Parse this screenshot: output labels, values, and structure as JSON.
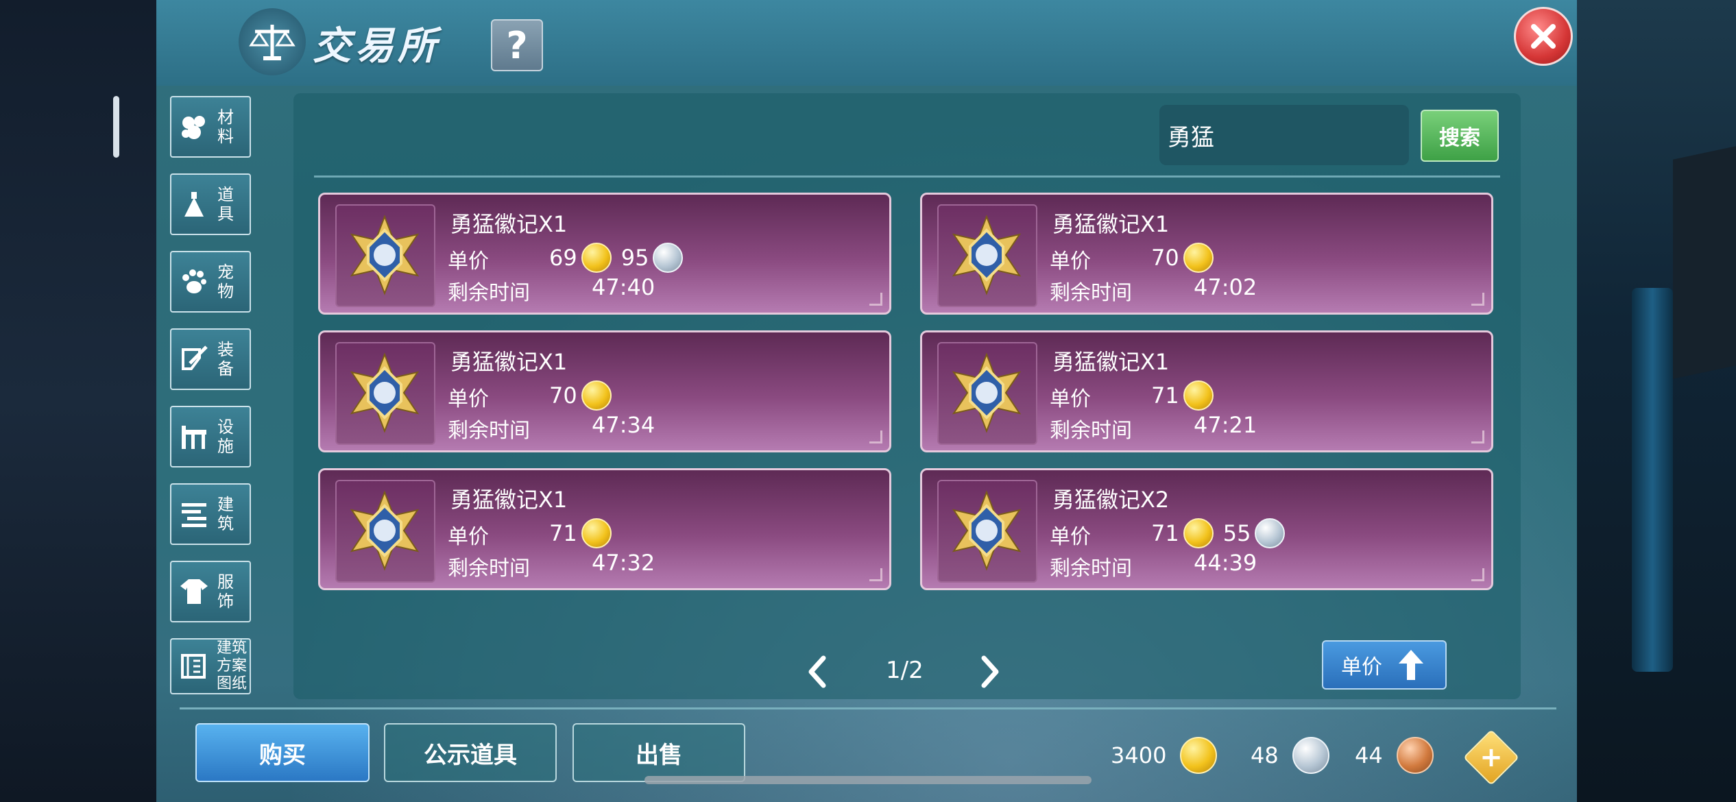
{
  "title": "交易所",
  "help_label": "?",
  "categories": [
    {
      "label": "材料",
      "icon": "materials-icon"
    },
    {
      "label": "道具",
      "icon": "item-icon"
    },
    {
      "label": "宠物",
      "icon": "paw-icon"
    },
    {
      "label": "装备",
      "icon": "equipment-icon"
    },
    {
      "label": "设施",
      "icon": "facility-icon"
    },
    {
      "label": "建筑",
      "icon": "building-icon"
    },
    {
      "label": "服饰",
      "icon": "clothing-icon"
    },
    {
      "label": "建筑方案图纸",
      "icon": "blueprint-icon"
    }
  ],
  "search": {
    "value": "勇猛",
    "button": "搜索"
  },
  "price_label": "单价",
  "time_label": "剩余时间",
  "listings": [
    {
      "name": "勇猛徽记X1",
      "gold": "69",
      "silver": "95",
      "time": "47:40"
    },
    {
      "name": "勇猛徽记X1",
      "gold": "70",
      "silver": "",
      "time": "47:02"
    },
    {
      "name": "勇猛徽记X1",
      "gold": "70",
      "silver": "",
      "time": "47:34"
    },
    {
      "name": "勇猛徽记X1",
      "gold": "71",
      "silver": "",
      "time": "47:21"
    },
    {
      "name": "勇猛徽记X1",
      "gold": "71",
      "silver": "",
      "time": "47:32"
    },
    {
      "name": "勇猛徽记X2",
      "gold": "71",
      "silver": "55",
      "time": "44:39"
    }
  ],
  "pager": {
    "current": 1,
    "total": 2,
    "text": "1/2"
  },
  "sort_button": "单价",
  "tabs": {
    "buy": "购买",
    "showcase": "公示道具",
    "sell": "出售"
  },
  "wallet": {
    "gold": "3400",
    "silver": "48",
    "copper": "44"
  },
  "plus_label": "+",
  "colors": {
    "gold": "#f2c21c",
    "silver": "#b6c6d4",
    "copper": "#d27a3e",
    "card": "#8a4a80",
    "search_btn": "#3ea146"
  }
}
